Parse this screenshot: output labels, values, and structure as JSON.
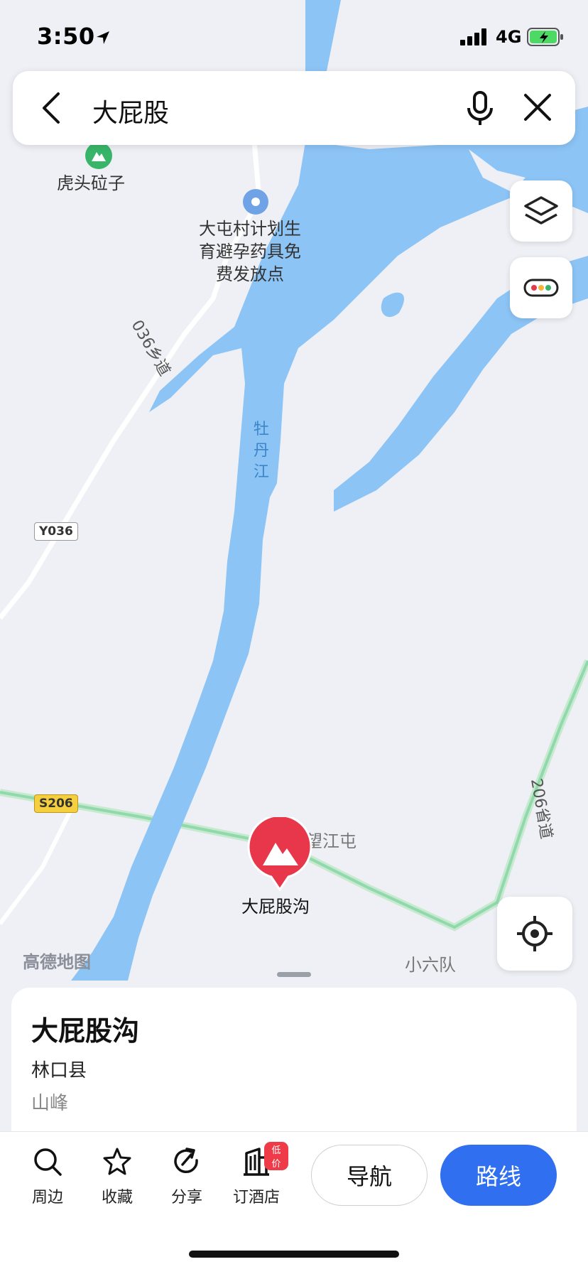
{
  "status_bar": {
    "time": "3:50",
    "network": "4G"
  },
  "search": {
    "query": "大屁股"
  },
  "map": {
    "labels": {
      "poi_mountain": "虎头砬子",
      "poi_clinic": "大屯村计划生育避孕药具免费发放点",
      "river": "牡丹江",
      "rural_road": "036乡道",
      "road_y036": "Y036",
      "road_s206": "S206",
      "provincial_road": "206省道",
      "village_1": "望江屯",
      "village_2": "小六队",
      "selected_pin": "大屁股沟",
      "watermark": "高德地图"
    },
    "colors": {
      "water": "#8cc4f6",
      "land": "#eef0f5",
      "road_green": "#9de0b8",
      "pin": "#e8364a"
    }
  },
  "controls": {
    "layers_icon": "layers-icon",
    "traffic_icon": "traffic-icon",
    "locate_icon": "locate-icon"
  },
  "place": {
    "name": "大屁股沟",
    "county": "林口县",
    "type": "山峰"
  },
  "toolbar": {
    "nearby": "周边",
    "favorite": "收藏",
    "share": "分享",
    "hotel": "订酒店",
    "hotel_badge": "低价",
    "navigate": "导航",
    "route": "路线"
  }
}
